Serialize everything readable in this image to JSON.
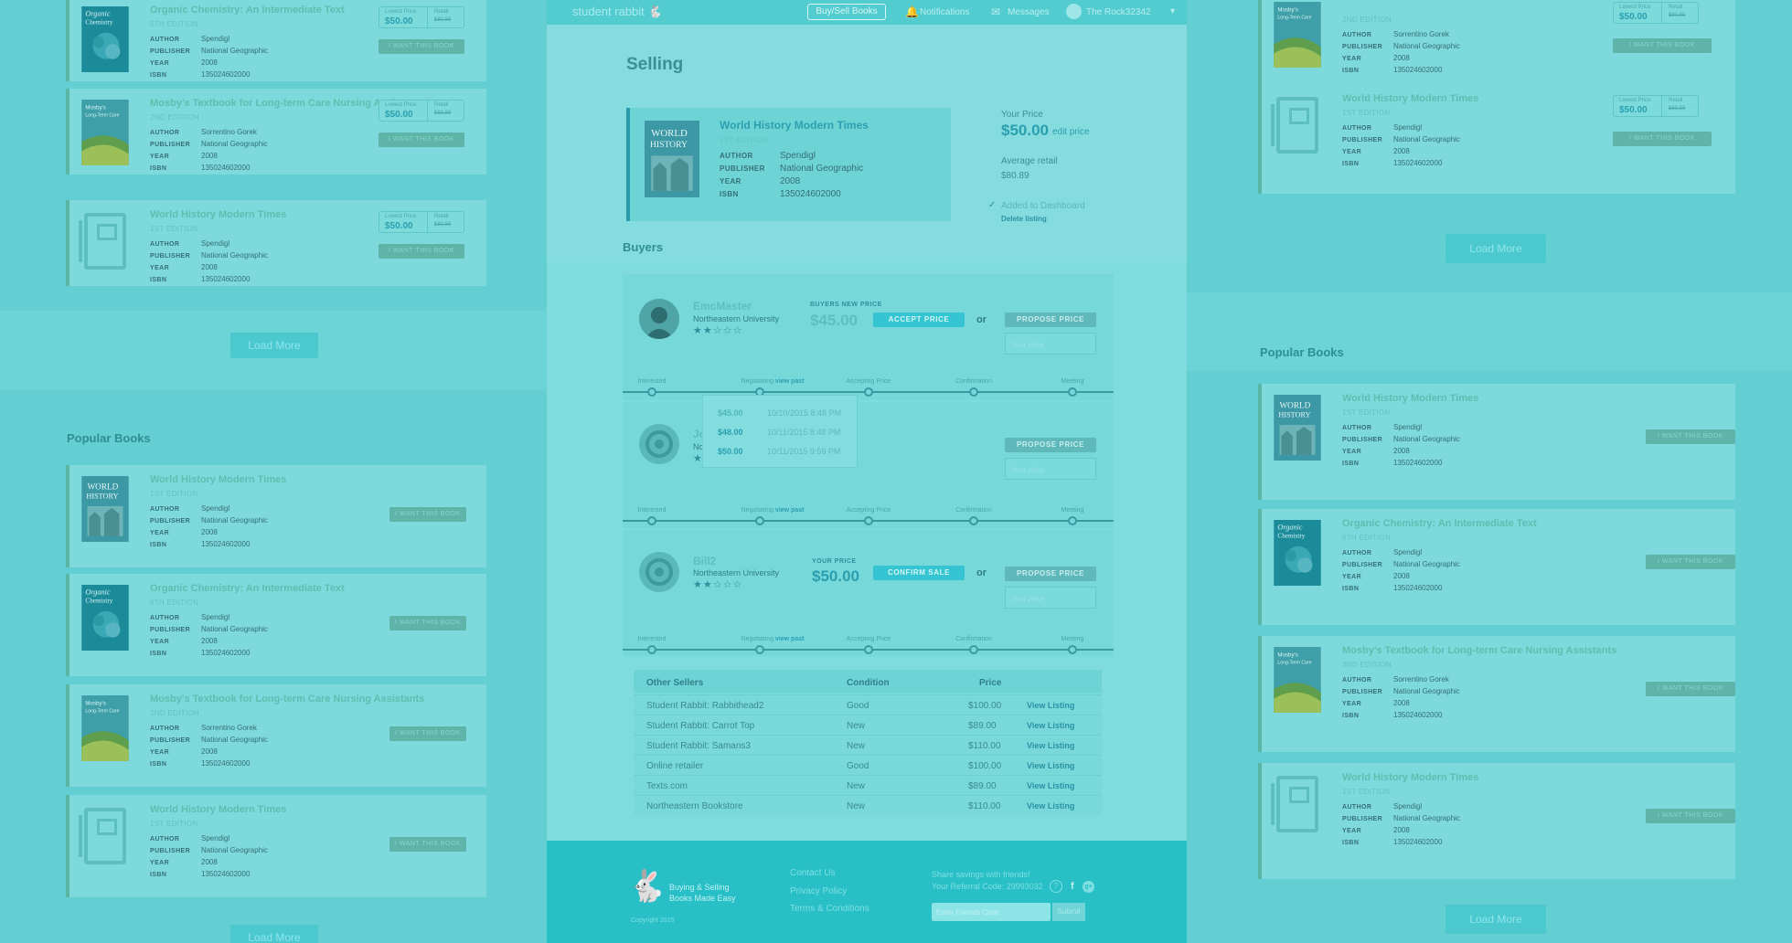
{
  "left": {
    "top_books": [
      {
        "title": "Organic Chemistry: An Intermediate Text",
        "edition": "6TH EDITION",
        "author": "Spendigl",
        "publisher": "National Geographic",
        "year": "2008",
        "isbn": "135024602000",
        "cover": "organic-chemistry",
        "lowest_price": "$50.00",
        "retail": "$80.89"
      },
      {
        "title": "Mosby's Textbook for Long-term Care Nursing Assistants",
        "edition": "2ND EDITION",
        "author": "Sorrentino Gorek",
        "publisher": "National Geographic",
        "year": "2008",
        "isbn": "135024602000",
        "cover": "mosbys",
        "lowest_price": "$50.00",
        "retail": "$80.89"
      },
      {
        "title": "World History Modern Times",
        "edition": "1ST EDITION",
        "author": "Spendigl",
        "publisher": "National Geographic",
        "year": "2008",
        "isbn": "135024602000",
        "cover": "placeholder",
        "lowest_price": "$50.00",
        "retail": "$80.89"
      }
    ],
    "load_more": "Load More",
    "popular_title": "Popular Books",
    "popular_books": [
      {
        "title": "World History Modern Times",
        "edition": "1ST EDITION",
        "author": "Spendigl",
        "publisher": "National Geographic",
        "year": "2008",
        "isbn": "135024602000",
        "cover": "world-history"
      },
      {
        "title": "Organic Chemistry: An Intermediate Text",
        "edition": "6TH EDITION",
        "author": "Spendigl",
        "publisher": "National Geographic",
        "year": "2008",
        "isbn": "135024602000",
        "cover": "organic-chemistry"
      },
      {
        "title": "Mosby's Textbook for Long-term Care Nursing Assistants",
        "edition": "2ND EDITION",
        "author": "Sorrentino Gorek",
        "publisher": "National Geographic",
        "year": "2008",
        "isbn": "135024602000",
        "cover": "mosbys"
      },
      {
        "title": "World History Modern Times",
        "edition": "1ST EDITION",
        "author": "Spendigl",
        "publisher": "National Geographic",
        "year": "2008",
        "isbn": "135024602000",
        "cover": "placeholder"
      }
    ],
    "load_more_bottom": "Load More"
  },
  "right": {
    "top_books": [
      {
        "title": "",
        "edition": "2ND EDITION",
        "author": "Sorrentino Gorek",
        "publisher": "National Geographic",
        "year": "2008",
        "isbn": "135024602000",
        "cover": "mosbys",
        "lowest_price": "$50.00",
        "retail": "$80.89"
      },
      {
        "title": "World History Modern Times",
        "edition": "1ST EDITION",
        "author": "Spendigl",
        "publisher": "National Geographic",
        "year": "2008",
        "isbn": "135024602000",
        "cover": "placeholder",
        "lowest_price": "$50.00",
        "retail": "$80.89"
      }
    ],
    "load_more": "Load More",
    "popular_title": "Popular Books",
    "popular_books": [
      {
        "title": "World History Modern Times",
        "edition": "1ST EDITION",
        "author": "Spendigl",
        "publisher": "National Geographic",
        "year": "2008",
        "isbn": "135024602000",
        "cover": "world-history"
      },
      {
        "title": "Organic Chemistry: An Intermediate Text",
        "edition": "6TH EDITION",
        "author": "Spendigl",
        "publisher": "National Geographic",
        "year": "2008",
        "isbn": "135024602000",
        "cover": "organic-chemistry"
      },
      {
        "title": "Mosby's Textbook for Long-term Care Nursing Assistants",
        "edition": "2ND EDITION",
        "author": "Sorrentino Gorek",
        "publisher": "National Geographic",
        "year": "2008",
        "isbn": "135024602000",
        "cover": "mosbys"
      },
      {
        "title": "World History Modern Times",
        "edition": "1ST EDITION",
        "author": "Spendigl",
        "publisher": "National Geographic",
        "year": "2008",
        "isbn": "135024602000",
        "cover": "placeholder"
      }
    ],
    "load_more_bottom": "Load More"
  },
  "labels": {
    "author": "AUTHOR",
    "publisher": "PUBLISHER",
    "year": "YEAR",
    "isbn": "ISBN",
    "lowest_price": "Lowest Price",
    "retail": "Retail",
    "want": "I WANT THIS BOOK"
  },
  "nav": {
    "logo": "student rabbit",
    "buy_sell": "Buy/Sell Books",
    "notifications": "Notifications",
    "messages": "Messages",
    "user": "The Rock32342"
  },
  "selling": {
    "title": "Selling",
    "book": {
      "title": "World History Modern Times",
      "edition": "1ST EDITION",
      "author": "Spendigl",
      "publisher": "National Geographic",
      "year": "2008",
      "isbn": "135024602000"
    },
    "your_price_label": "Your Price",
    "your_price": "$50.00",
    "edit_price": "edit price",
    "avg_retail_label": "Average retail",
    "avg_retail": "$80.89",
    "added": "Added to Dashboard",
    "delete": "Delete listing"
  },
  "buyers": {
    "title": "Buyers",
    "stages": [
      "Interested",
      "Negotiating",
      "Accepting Price",
      "Confirmation",
      "Meeting"
    ],
    "view_past": "view past",
    "or": "or",
    "propose": "PROPOSE PRICE",
    "your_price_placeholder": "Your price",
    "list": [
      {
        "name": "EmcMaster",
        "university": "Northeastern University",
        "rating": 2,
        "price_label": "BUYERS NEW PRICE",
        "price": "$45.00",
        "action": "ACCEPT PRICE",
        "avatar": "photo"
      },
      {
        "name": "Jo",
        "university": "No",
        "rating": 1,
        "price_label": "",
        "price": "",
        "action": "",
        "avatar": "default"
      },
      {
        "name": "Bill2",
        "university": "Northeastern University",
        "rating": 2,
        "price_label": "YOUR PRICE",
        "price": "$50.00",
        "action": "CONFIRM SALE",
        "avatar": "default"
      }
    ],
    "history": [
      {
        "price": "$45.00",
        "date": "10/10/2015 8:48 PM"
      },
      {
        "price": "$48.00",
        "date": "10/11/2015 8:48 PM"
      },
      {
        "price": "$50.00",
        "date": "10/11/2015 9:59 PM"
      }
    ]
  },
  "other_sellers": {
    "headers": [
      "Other Sellers",
      "Condition",
      "Price"
    ],
    "rows": [
      {
        "seller": "Student Rabbit: Rabbithead2",
        "condition": "Good",
        "price": "$100.00",
        "link": "View Listing"
      },
      {
        "seller": "Student Rabbit: Carrot Top",
        "condition": "New",
        "price": "$89.00",
        "link": "View Listing"
      },
      {
        "seller": "Student Rabbit: Samans3",
        "condition": "New",
        "price": "$110.00",
        "link": "View Listing"
      },
      {
        "seller": "Online retailer",
        "condition": "Good",
        "price": "$100.00",
        "link": "View Listing"
      },
      {
        "seller": "Texts.com",
        "condition": "New",
        "price": "$89.00",
        "link": "View Listing"
      },
      {
        "seller": "Northeastern Bookstore",
        "condition": "New",
        "price": "$110.00",
        "link": "View Listing"
      }
    ]
  },
  "footer": {
    "tagline_1": "Buying & Selling",
    "tagline_2": "Books Made Easy",
    "copyright": "Copyright 2015",
    "links": [
      "Contact Us",
      "Privacy Policy",
      "Terms & Conditions"
    ],
    "share": "Share savings with friends!",
    "referral": "Your Referral Code: 29993032",
    "email_placeholder": "Enter Friends Code",
    "submit": "Submit"
  }
}
